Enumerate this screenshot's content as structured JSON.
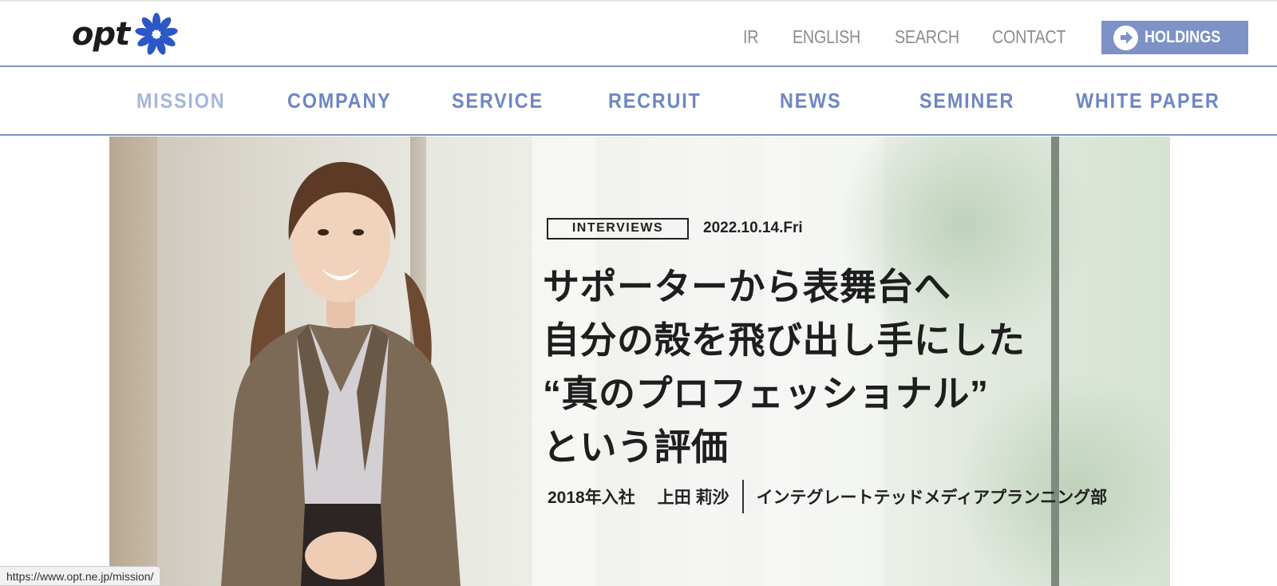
{
  "header": {
    "logo_text": "opt",
    "util_links": [
      "IR",
      "ENGLISH",
      "SEARCH",
      "CONTACT"
    ],
    "holdings_label": "HOLDINGS"
  },
  "nav": {
    "items": [
      "MISSION",
      "COMPANY",
      "SERVICE",
      "RECRUIT",
      "NEWS",
      "SEMINER",
      "WHITE PAPER"
    ],
    "active": "MISSION"
  },
  "article": {
    "tag": "INTERVIEWS",
    "date": "2022.10.14.Fri",
    "title_lines": [
      "サポーターから表舞台へ",
      "自分の殻を飛び出し手にした",
      "“真のプロフェッショナル”",
      "という評価"
    ],
    "joined": "2018年入社",
    "name": "上田 莉沙",
    "department": "インテグレートテッドメディアプランニング部"
  },
  "status_url": "https://www.opt.ne.jp/mission/",
  "colors": {
    "accent": "#7d92c6",
    "nav_text": "#6e86c2",
    "nav_active": "#a5b5dd",
    "util_text": "#8d8d8d",
    "logo_star": "#2c57c7"
  }
}
